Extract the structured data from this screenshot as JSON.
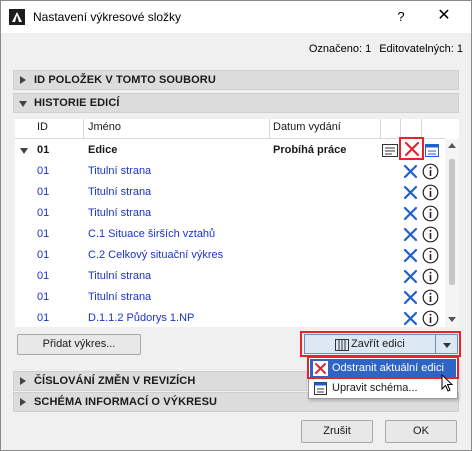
{
  "window": {
    "title": "Nastavení výkresové složky",
    "help_label": "?",
    "close_label": "✕"
  },
  "selected_info": {
    "selected": "Označeno: 1",
    "editable": "Editovatelných: 1"
  },
  "sections": {
    "ids": "ID POLOŽEK V TOMTO SOUBORU",
    "history": "HISTORIE EDICÍ",
    "changes": "ČÍSLOVÁNÍ ZMĚN V REVIZÍCH",
    "schema": "SCHÉMA INFORMACÍ O VÝKRESU"
  },
  "table": {
    "columns": {
      "id": "ID",
      "name": "Jméno",
      "date": "Datum vydání"
    },
    "parent_row": {
      "id": "01",
      "name": "Edice",
      "status": "Probíhá práce"
    },
    "rows": [
      {
        "id": "01",
        "name": "Titulní strana"
      },
      {
        "id": "01",
        "name": "Titulní strana"
      },
      {
        "id": "01",
        "name": "Titulní strana"
      },
      {
        "id": "01",
        "name": "C.1 Situace širších vztahů"
      },
      {
        "id": "01",
        "name": "C.2 Celkový situační výkres"
      },
      {
        "id": "01",
        "name": "Titulní strana"
      },
      {
        "id": "01",
        "name": "Titulní strana"
      },
      {
        "id": "01",
        "name": "D.1.1.2 Půdorys 1.NP"
      }
    ]
  },
  "buttons": {
    "add_drawing": "Přidat výkres...",
    "close_edition": "Zavřít edici",
    "cancel": "Zrušit",
    "ok": "OK"
  },
  "dropdown": {
    "items": [
      "Odstranit aktuální edici",
      "Upravit schéma..."
    ]
  },
  "colors": {
    "highlight_red": "#e3262b",
    "link_blue": "#1b33c7",
    "icon_blue": "#1f5fd0",
    "menu_highlight": "#2e64c5"
  }
}
